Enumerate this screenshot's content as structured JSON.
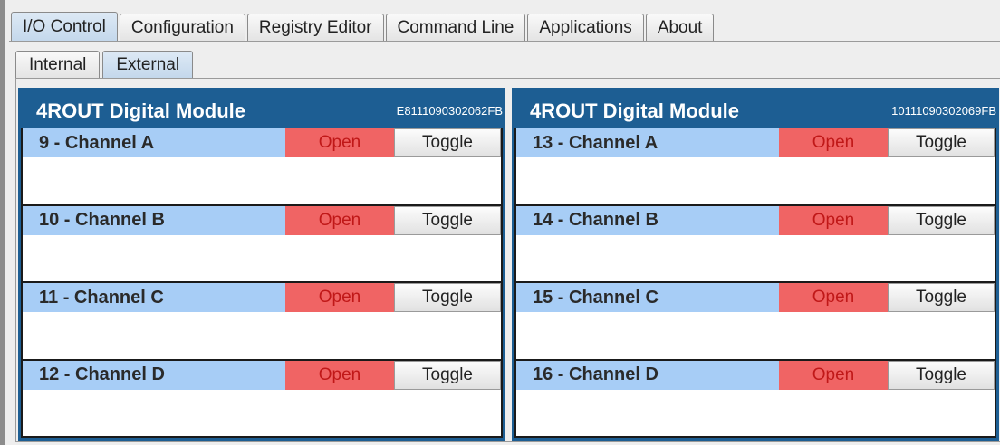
{
  "tabs": [
    {
      "label": "I/O Control",
      "active": true
    },
    {
      "label": "Configuration",
      "active": false
    },
    {
      "label": "Registry Editor",
      "active": false
    },
    {
      "label": "Command Line",
      "active": false
    },
    {
      "label": "Applications",
      "active": false
    },
    {
      "label": "About",
      "active": false
    }
  ],
  "subtabs": [
    {
      "label": "Internal",
      "active": false
    },
    {
      "label": "External",
      "active": true
    }
  ],
  "colors": {
    "module_header": "#1d5e93",
    "channel_bar": "#a7cdf6",
    "state_open_bg": "#f06464",
    "state_open_text": "#c01818"
  },
  "modules": [
    {
      "title": "4ROUT Digital Module",
      "serial": "E8111090302062FB",
      "channels": [
        {
          "name": "9 - Channel A",
          "state": "Open",
          "button": "Toggle"
        },
        {
          "name": "10 - Channel B",
          "state": "Open",
          "button": "Toggle"
        },
        {
          "name": "11 - Channel C",
          "state": "Open",
          "button": "Toggle"
        },
        {
          "name": "12 - Channel D",
          "state": "Open",
          "button": "Toggle"
        }
      ]
    },
    {
      "title": "4ROUT Digital Module",
      "serial": "10111090302069FB",
      "channels": [
        {
          "name": "13 - Channel A",
          "state": "Open",
          "button": "Toggle"
        },
        {
          "name": "14 - Channel B",
          "state": "Open",
          "button": "Toggle"
        },
        {
          "name": "15 - Channel C",
          "state": "Open",
          "button": "Toggle"
        },
        {
          "name": "16 - Channel D",
          "state": "Open",
          "button": "Toggle"
        }
      ]
    }
  ]
}
